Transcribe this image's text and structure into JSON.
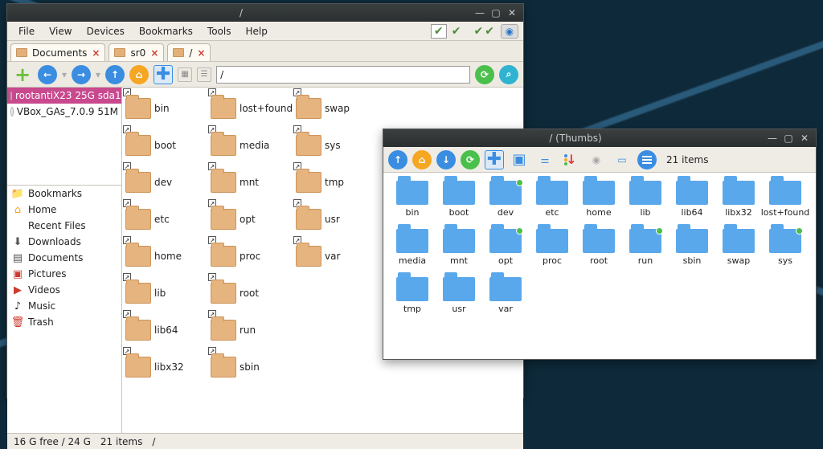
{
  "win1": {
    "title": "/",
    "menus": [
      "File",
      "View",
      "Devices",
      "Bookmarks",
      "Tools",
      "Help"
    ],
    "tabs": [
      {
        "label": "Documents"
      },
      {
        "label": "sr0"
      },
      {
        "label": "/"
      }
    ],
    "path": "/",
    "devices": [
      {
        "label": "rootantiX23 25G sda1",
        "selected": true,
        "icon": "hdd"
      },
      {
        "label": "VBox_GAs_7.0.9 51M",
        "selected": false,
        "icon": "disc"
      }
    ],
    "places": [
      {
        "label": "Bookmarks",
        "icon": "📁",
        "color": "#e4b07a"
      },
      {
        "label": "Home",
        "icon": "⌂",
        "color": "#f5a623"
      },
      {
        "label": "Recent Files",
        "icon": "",
        "color": "#888"
      },
      {
        "label": "Downloads",
        "icon": "⬇",
        "color": "#555"
      },
      {
        "label": "Documents",
        "icon": "▤",
        "color": "#555"
      },
      {
        "label": "Pictures",
        "icon": "▣",
        "color": "#cc3b2e"
      },
      {
        "label": "Videos",
        "icon": "▶",
        "color": "#cc3b2e"
      },
      {
        "label": "Music",
        "icon": "♪",
        "color": "#333"
      },
      {
        "label": "Trash",
        "icon": "🗑",
        "color": "#cc3b2e"
      }
    ],
    "folders_col1": [
      "bin",
      "boot",
      "dev",
      "etc",
      "home",
      "lib",
      "lib64",
      "libx32"
    ],
    "folders_col2": [
      "lost+found",
      "media",
      "mnt",
      "opt",
      "proc",
      "root",
      "run",
      "sbin"
    ],
    "folders_col3": [
      "swap",
      "sys",
      "tmp",
      "usr",
      "var"
    ],
    "status": {
      "free": "16 G free / 24 G",
      "items": "21 items",
      "path": "/"
    }
  },
  "win2": {
    "title": "/ (Thumbs)",
    "count": "21 items",
    "folders": [
      {
        "n": "bin"
      },
      {
        "n": "boot"
      },
      {
        "n": "dev",
        "d": true
      },
      {
        "n": "etc"
      },
      {
        "n": "home"
      },
      {
        "n": "lib"
      },
      {
        "n": "lib64"
      },
      {
        "n": "libx32"
      },
      {
        "n": "lost+found"
      },
      {
        "n": "media"
      },
      {
        "n": "mnt"
      },
      {
        "n": "opt",
        "d": true
      },
      {
        "n": "proc"
      },
      {
        "n": "root"
      },
      {
        "n": "run",
        "d": true
      },
      {
        "n": "sbin"
      },
      {
        "n": "swap"
      },
      {
        "n": "sys",
        "d": true
      },
      {
        "n": "tmp"
      },
      {
        "n": "usr"
      },
      {
        "n": "var"
      }
    ]
  }
}
